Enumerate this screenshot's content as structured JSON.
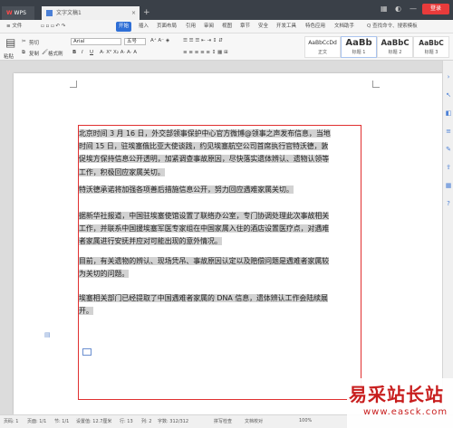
{
  "title_bar": {
    "app_tab": "WPS",
    "doc_tab": "文字文稿1",
    "new_tab": "+",
    "close": "×",
    "badge": "登录"
  },
  "menu": {
    "items": [
      "≡ 文件",
      "开始",
      "插入",
      "页面布局",
      "引用",
      "审阅",
      "视图",
      "章节",
      "安全",
      "开发工具",
      "特色应用",
      "文档助手"
    ],
    "active": "开始",
    "search": "Q 查找命令、搜索模板"
  },
  "ribbon": {
    "paste": "粘贴",
    "cut": "剪切",
    "copy": "复制",
    "format_painter": "格式刷",
    "font_name": "Arial",
    "font_size": "五号",
    "bold": "B",
    "italic": "I",
    "underline": "U",
    "styles": [
      {
        "preview": "AaBbCcDd",
        "name": "正文"
      },
      {
        "preview": "AaBb",
        "name": "标题 1"
      },
      {
        "preview": "AaBbC",
        "name": "标题 2"
      },
      {
        "preview": "AaBbC",
        "name": "标题 3"
      }
    ]
  },
  "document": {
    "paragraphs": [
      [
        "北京时间 3 月 16 日，外交部领事保护中心官方微博@领事之声发布信息，当地",
        "时间 15 日，驻埃塞俄比亚大使谈践，约见埃塞航空公司首席执行官特沃德，敦",
        "促埃方保持信息公开透明，加紧调查事故原因，尽快落实遗体辨认、遗物认领等",
        "工作，积极回应家属关切。"
      ],
      [
        "特沃德承诺将加强各项善后措施信息公开，努力回应遇难家属关切。"
      ],
      [
        "据新华社报道，中国驻埃塞使馆设置了联络办公室，专门协调处理此次事故相关",
        "工作，并联系中国援埃塞军医专家组在中国家属入住的酒店设置医疗点，对遇难",
        "者家属进行安抚并应对可能出现的意外情况。"
      ],
      [
        "目前，有关遗物的辨认、现场凭吊、事故原因认定以及赔偿问题是遇难者家属较",
        "为关切的问题。"
      ],
      [
        "埃塞相关部门已经提取了中国遇难者家属的 DNA 信息，遗体辨认工作会陆续展",
        "开。"
      ]
    ]
  },
  "status_bar": {
    "page_num": "页码: 1",
    "pages": "页面: 1/1",
    "section": "节: 1/1",
    "setting": "设置值: 12.7厘米",
    "row": "行: 13",
    "col": "列: 2",
    "words": "字数: 312/312",
    "spell": "拼写检查",
    "doc_check": "文档校对",
    "zoom": "100%"
  },
  "watermark": {
    "line1": "易采站长站",
    "line2": "www.easck.com"
  },
  "colors": {
    "accent": "#2f6fd6",
    "selection_border": "#e03030",
    "highlight": "#d2d2d2"
  }
}
